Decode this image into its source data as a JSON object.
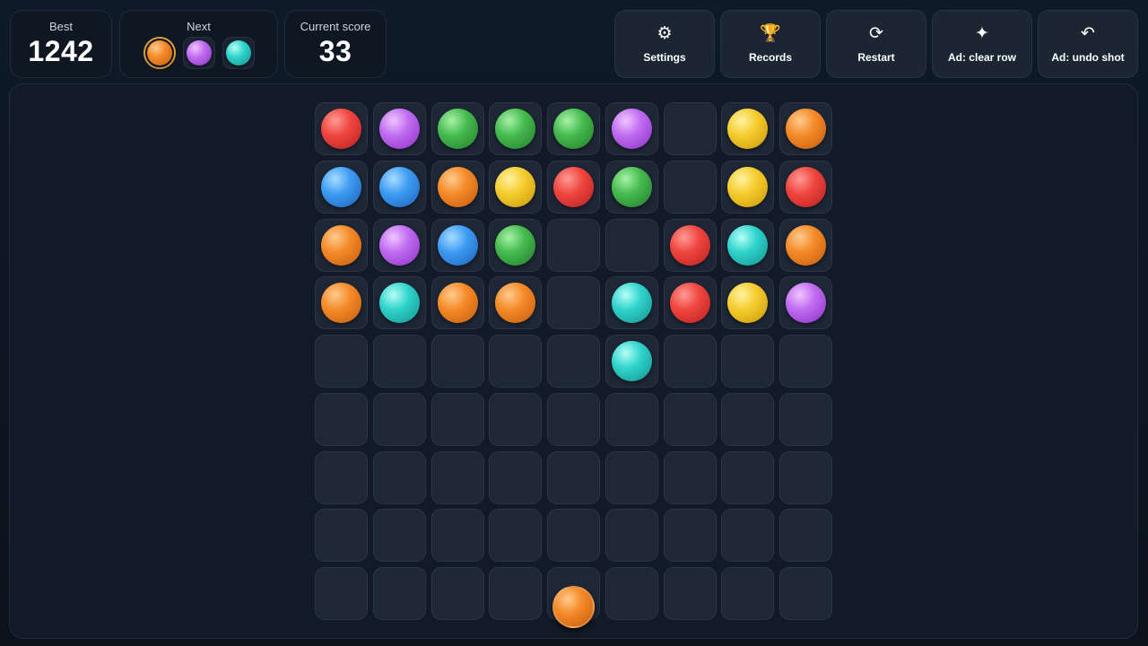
{
  "best": {
    "label": "Best",
    "value": "1242"
  },
  "next": {
    "label": "Next",
    "balls": [
      "orange",
      "purple",
      "cyan"
    ]
  },
  "score": {
    "label": "Current score",
    "value": "33"
  },
  "buttons": {
    "settings": {
      "label": "Settings",
      "icon": "⚙"
    },
    "records": {
      "label": "Records",
      "icon": "🏆"
    },
    "restart": {
      "label": "Restart",
      "icon": "⟳"
    },
    "clear_row": {
      "label": "Ad: clear row",
      "icon": "✦"
    },
    "undo_shot": {
      "label": "Ad: undo shot",
      "icon": "↶"
    }
  },
  "colors": {
    "red": "#f0453f",
    "purple": "#bf6cf0",
    "green": "#46bb4f",
    "yellow": "#f5cc2e",
    "orange": "#f48a28",
    "blue": "#3d9cf2",
    "cyan": "#2fd3cb"
  },
  "board": [
    [
      "red",
      "purple",
      "green",
      "green",
      "green",
      "purple",
      null,
      "yellow",
      "orange"
    ],
    [
      "blue",
      "blue",
      "orange",
      "yellow",
      "red",
      "green",
      null,
      "yellow",
      "red"
    ],
    [
      "orange",
      "purple",
      "blue",
      "green",
      null,
      null,
      "red",
      "cyan",
      "orange"
    ],
    [
      "orange",
      "cyan",
      "orange",
      "orange",
      null,
      "cyan",
      "red",
      "yellow",
      "purple"
    ],
    [
      null,
      null,
      null,
      null,
      null,
      "cyan",
      null,
      null,
      null
    ],
    [
      null,
      null,
      null,
      null,
      null,
      null,
      null,
      null,
      null
    ],
    [
      null,
      null,
      null,
      null,
      null,
      null,
      null,
      null,
      null
    ],
    [
      null,
      null,
      null,
      null,
      null,
      null,
      null,
      null,
      null
    ],
    [
      null,
      null,
      null,
      null,
      null,
      null,
      null,
      null,
      null
    ]
  ],
  "shooter": {
    "color": "orange",
    "column": 5
  }
}
